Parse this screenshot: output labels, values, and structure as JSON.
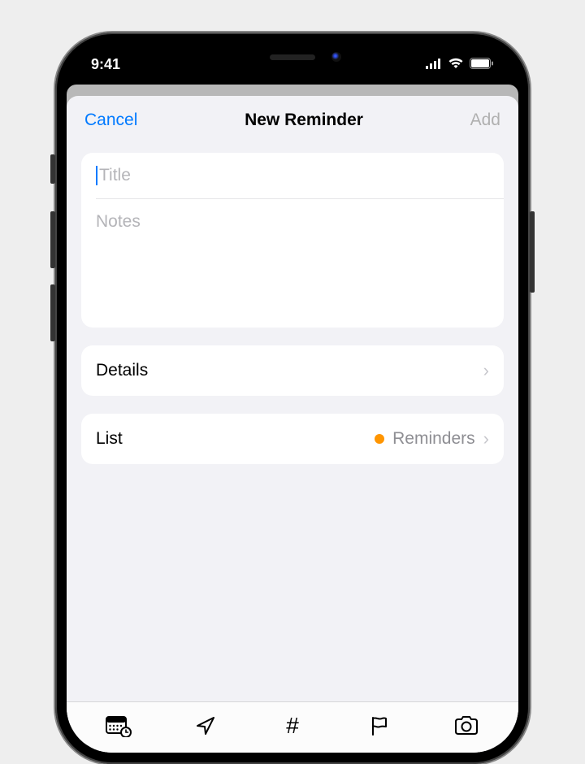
{
  "statusBar": {
    "time": "9:41"
  },
  "sheet": {
    "cancel": "Cancel",
    "title": "New Reminder",
    "add": "Add"
  },
  "inputs": {
    "titlePlaceholder": "Title",
    "notesPlaceholder": "Notes"
  },
  "rows": {
    "details": "Details",
    "list": "List",
    "listValue": "Reminders"
  },
  "listDotColor": "#ff9500"
}
